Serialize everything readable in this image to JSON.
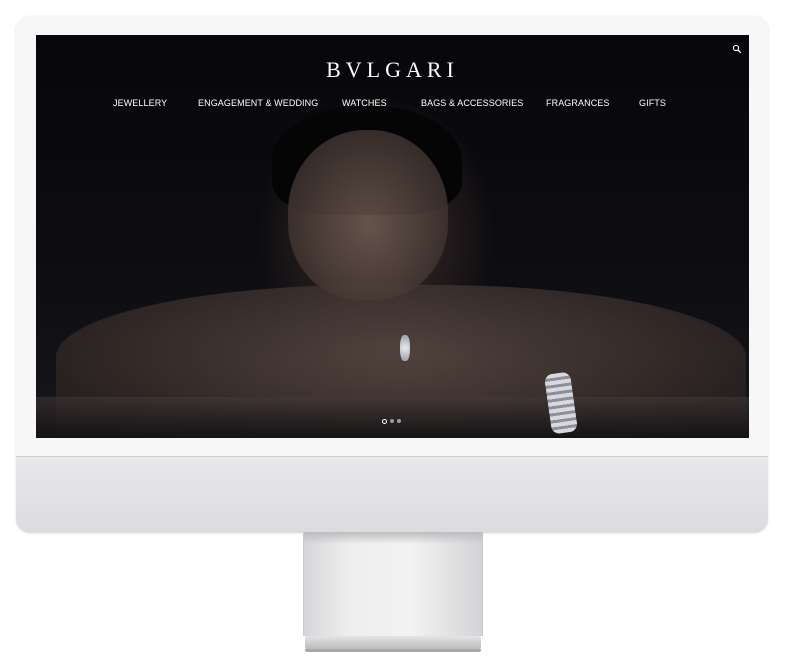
{
  "site": {
    "logo_text": "BVLGARI"
  },
  "header": {
    "search_icon": "search-icon"
  },
  "nav": {
    "items": [
      {
        "label": "JEWELLERY"
      },
      {
        "label": "ENGAGEMENT & WEDDING"
      },
      {
        "label": "WATCHES"
      },
      {
        "label": "BAGS & ACCESSORIES"
      },
      {
        "label": "FRAGRANCES"
      },
      {
        "label": "GIFTS"
      }
    ]
  },
  "hero": {
    "slides_total": 3,
    "active_slide": 1
  },
  "colors": {
    "screen_background": "#0b0b10",
    "text": "#ffffff",
    "device_body": "#f4f4f5"
  }
}
